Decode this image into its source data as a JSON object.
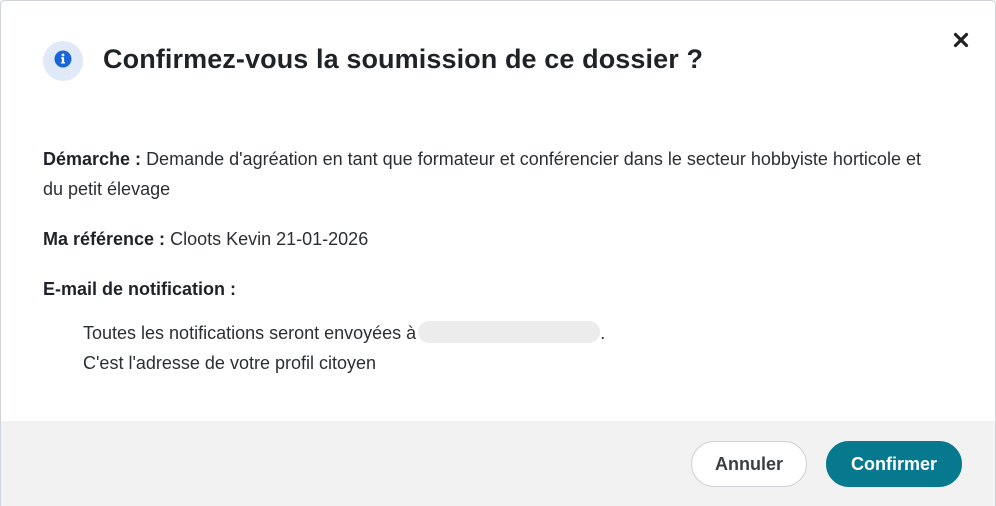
{
  "dialog": {
    "title": "Confirmez-vous la soumission de ce dossier ?",
    "close_symbol": "✖",
    "icons": {
      "header": "info-circle-icon",
      "close": "close-icon"
    }
  },
  "details": {
    "demarche_label": "Démarche :",
    "demarche_value": "Demande d'agréation en tant que formateur et conférencier dans le secteur hobbyiste horticole et du petit élevage",
    "reference_label": "Ma référence :",
    "reference_value": "Cloots Kevin 21-01-2026",
    "email_label": "E-mail de notification :",
    "notif_line_prefix": "Toutes les notifications seront envoyées à",
    "notif_line_suffix": ".",
    "notif_line2": "C'est l'adresse de votre profil citoyen"
  },
  "actions": {
    "cancel_label": "Annuler",
    "confirm_label": "Confirmer"
  },
  "colors": {
    "primary": "#07798f",
    "info_icon": "#1a66d6",
    "info_badge_bg": "#dfe9f8",
    "footer_bg": "#f2f2f2"
  }
}
